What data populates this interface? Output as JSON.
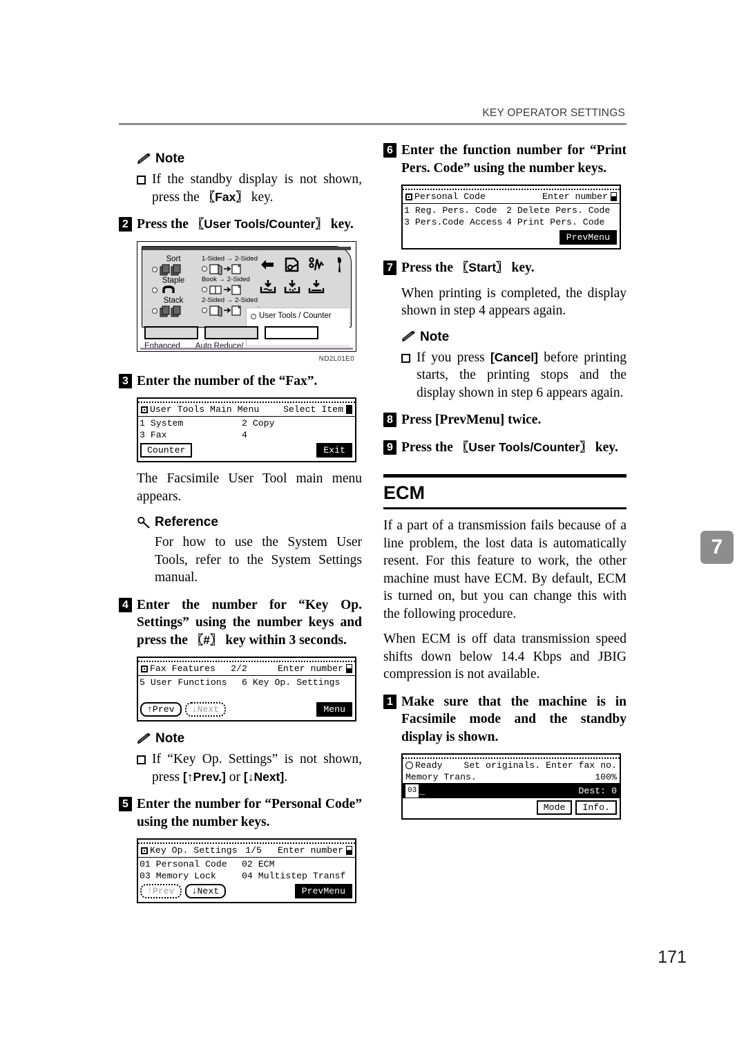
{
  "header": {
    "title": "KEY OPERATOR SETTINGS"
  },
  "chapter_tab": "7",
  "folio": "171",
  "left_column": {
    "note1": {
      "label": "Note",
      "items": [
        "If the standby display is not shown, press the [Fax] key."
      ],
      "item1_pre": "If the standby display is not shown, press the ",
      "item1_key": "Fax",
      "item1_post": " key."
    },
    "step2": {
      "num": "2",
      "pre": "Press the ",
      "key": "User Tools/Counter",
      "post": " key."
    },
    "control_panel": {
      "fig_id": "ND2L01E0",
      "finisher": [
        {
          "label": "Sort",
          "icon": "sort-icon"
        },
        {
          "label": "Staple",
          "icon": "staple-icon"
        },
        {
          "label": "Stack",
          "icon": "stack-icon"
        }
      ],
      "duplex": [
        {
          "label": "1-Sided → 2-Sided",
          "icon": "one-sided-to-two-sided-icon"
        },
        {
          "label": "Book → 2-Sided",
          "icon": "book-to-two-sided-icon"
        },
        {
          "label": "2-Sided → 2-Sided",
          "icon": "two-sided-to-two-sided-icon"
        }
      ],
      "user_tools_label": "User Tools / Counter",
      "bottom_labels": [
        "Enhanced",
        "Auto Reduce/"
      ]
    },
    "step3": {
      "num": "3",
      "text": "Enter the number of the “Fax”."
    },
    "lcd_main_menu": {
      "title": "User Tools Main Menu",
      "hint": "Select Item",
      "rows": [
        {
          "c1": "1 System",
          "c2": "2 Copy"
        },
        {
          "c1": "3 Fax",
          "c2": "4"
        }
      ],
      "btn_left": "Counter",
      "btn_right": "Exit"
    },
    "para_after_lcd": "The Facsimile User Tool main menu appears.",
    "reference": {
      "label": "Reference",
      "text": "For how to use the System User Tools, refer to the System Settings manual."
    },
    "step4": {
      "num": "4",
      "pre": "Enter the number for “Key Op. Settings” using the number keys and press the ",
      "key": "#",
      "post": " key within 3 seconds."
    },
    "lcd_fax_features": {
      "title": "Fax Features",
      "page": "2/2",
      "hint": "Enter number",
      "rows": [
        {
          "c1": "5 User Functions",
          "c2": "6 Key Op. Settings"
        }
      ],
      "btn_prev": "↑Prev",
      "btn_next": "↓Next",
      "btn_menu": "Menu"
    },
    "note2": {
      "label": "Note",
      "item_pre": "If “Key Op. Settings” is not shown, press ",
      "key_prev": "[↑Prev.]",
      "item_mid": " or ",
      "key_next": "[↓Next]",
      "item_post": "."
    },
    "step5": {
      "num": "5",
      "text": "Enter the number for “Personal Code” using the number keys."
    },
    "lcd_key_op": {
      "title": "Key Op. Settings",
      "page": "1/5",
      "hint": "Enter number",
      "rows": [
        {
          "c1": "01 Personal Code",
          "c2": "02 ECM"
        },
        {
          "c1": "03 Memory Lock",
          "c2": "04 Multistep Transf"
        }
      ],
      "btn_prev": "↑Prev",
      "btn_next": "↓Next",
      "btn_menu": "PrevMenu"
    }
  },
  "right_column": {
    "step6": {
      "num": "6",
      "text": "Enter the function number for “Print Pers. Code” using the number keys."
    },
    "lcd_personal_code": {
      "title": "Personal Code",
      "hint": "Enter number",
      "rows": [
        {
          "c1": "1 Reg. Pers. Code",
          "c2": "2 Delete Pers. Code"
        },
        {
          "c1": "3 Pers.Code Access",
          "c2": "4 Print Pers. Code"
        }
      ],
      "btn_menu": "PrevMenu"
    },
    "step7": {
      "num": "7",
      "pre": "Press the ",
      "key": "Start",
      "post": " key."
    },
    "para7": "When printing is completed, the display shown in step 4 appears again.",
    "note3": {
      "label": "Note",
      "item_pre": "If you press ",
      "key": "[Cancel]",
      "item_post": " before printing starts, the printing stops and the display shown in step 6 appears again."
    },
    "step8": {
      "num": "8",
      "text": "Press [PrevMenu] twice."
    },
    "step9": {
      "num": "9",
      "pre": "Press the ",
      "key": "User Tools/Counter",
      "post": " key."
    },
    "ecm_section": {
      "title": "ECM",
      "para1": "If a part of a transmission fails because of a line problem, the lost data is automatically resent. For this feature to work, the other machine must have ECM. By default, ECM is turned on, but you can change this with the following procedure.",
      "para2": "When ECM is off data transmission speed shifts down below 14.4 Kbps and JBIG compression is not available."
    },
    "step_a": {
      "num": "1",
      "text": "Make sure that the machine is in Facsimile mode and the standby display is shown."
    },
    "lcd_standby": {
      "status_left": "Ready",
      "status_right": "Set originals. Enter fax no.",
      "mode_label": "Memory Trans.",
      "memory_pct": "100%",
      "badge": "03",
      "dest_label": "Dest:",
      "dest_value": "0",
      "btn_mode": "Mode",
      "btn_info": "Info."
    }
  }
}
